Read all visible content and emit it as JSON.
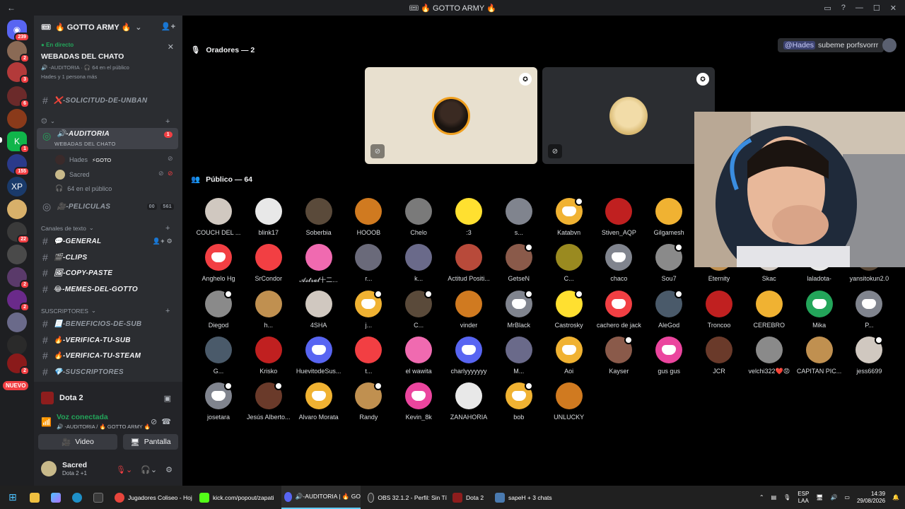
{
  "window": {
    "title": "🎟 🔥 GOTTO ARMY 🔥"
  },
  "guilds": {
    "home_badge": "239",
    "badges": [
      "2",
      "3",
      "6",
      "1",
      "155",
      "22",
      "2",
      "2",
      "2"
    ],
    "new_label": "NUEVO"
  },
  "server": {
    "name": "🔥 GOTTO ARMY 🔥"
  },
  "live": {
    "tag": "En directo",
    "title": "WEBADAS DEL CHATO",
    "sub1": "🔊 -AUDITORIA · 🎧 64 en el público",
    "sub2": "Hades y 1 persona más"
  },
  "channels": {
    "unban": "❌-SOLICITUD-DE-UNBAN",
    "voice_cat": "😊",
    "auditoria": "🔊-AUDITORIA",
    "auditoria_badge": "1",
    "auditoria_event": "WEBADAS DEL CHATO",
    "users": [
      {
        "name": "Hades",
        "extra": "⚡GOTO"
      },
      {
        "name": "Sacred",
        "extra": ""
      }
    ],
    "audience": "64 en el público",
    "peliculas": "🎥-PELICULAS",
    "peliculas_counts": [
      "00",
      "561"
    ],
    "text_cat": "Canales de texto",
    "text": [
      "💬-GENERAL",
      "🎬-CLIPS",
      "🖼-COPY-PASTE",
      "😂-MEMES-DEL-GOTTO"
    ],
    "sub_cat": "SUSCRIPTORES",
    "sub": [
      "📃-BENEFICIOS-DE-SUB",
      "🔥-VERIFICA-TU-SUB",
      "🔥-VERIFICA-TU-STEAM",
      "💎-SUSCRIPTORES"
    ]
  },
  "panel": {
    "game": "Dota 2",
    "voice_status": "Voz conectada",
    "voice_channel": "🔊 -AUDITORIA / 🔥 GOTTO ARMY 🔥",
    "video_label": "Video",
    "screen_label": "Pantalla",
    "user": "Sacred",
    "user_status": "Dota 2 +1"
  },
  "stage": {
    "speakers_label": "Oradores — 2",
    "audience_label": "Público — 64",
    "chat_mention": "@Hades",
    "chat_text": "subeme porfsvorrr",
    "audience": [
      [
        "COUCH DEL ...",
        "blink17",
        "Soberbia",
        "HOOOB",
        "Chelo",
        ":3",
        "s...",
        "Katabvn",
        "Stiven_AQP",
        "Gilgamesh"
      ],
      [
        "Anghelo Hg",
        "SrCondor",
        "𝓐𝓼𝓽𝓻𝓪𝓵十二...",
        "r...",
        "k...",
        "Actitud Positi...",
        "GetseN",
        "C...",
        "chaco",
        "Sou7",
        "Eternity",
        "Skac",
        "laladota-",
        "yansitokun2.0"
      ],
      [
        "Diegod",
        "h...",
        "4SHA",
        "j...",
        "C...",
        "vinder",
        "MrBlack",
        "Castrosky",
        "cachero de jack",
        "AleGod",
        "Troncoo",
        "CEREBRO",
        "Mika",
        "P..."
      ],
      [
        "G...",
        "Krisko",
        "HuevitodeSus...",
        "t...",
        "el wawita",
        "charlyyyyyyy",
        "M...",
        "Aoi",
        "Kayser",
        "gus gus",
        "JCR",
        "velchi322❤️😡",
        "CAPITAN PIC...",
        "jess6699"
      ],
      [
        "josetara",
        "Jesús Alberto...",
        "Alvaro Morata",
        "Randy",
        "Kevin_8k",
        "ZANAHORIA",
        "bob",
        "UNLUCKY"
      ]
    ]
  },
  "taskbar": {
    "items": [
      "Jugadores Coliseo - Hoj",
      "kick.com/popout/zapati",
      "🔊-AUDITORIA | 🔥 GO",
      "OBS 32.1.2 - Perfil: Sin Tí",
      "Dota 2",
      "sapeH + 3 chats"
    ],
    "lang": "ESP",
    "lang2": "LAA",
    "time": "14:39",
    "date": "29/08/2026"
  },
  "colors": {
    "accent": "#5865f2",
    "online": "#23a55a",
    "danger": "#f23f43"
  }
}
